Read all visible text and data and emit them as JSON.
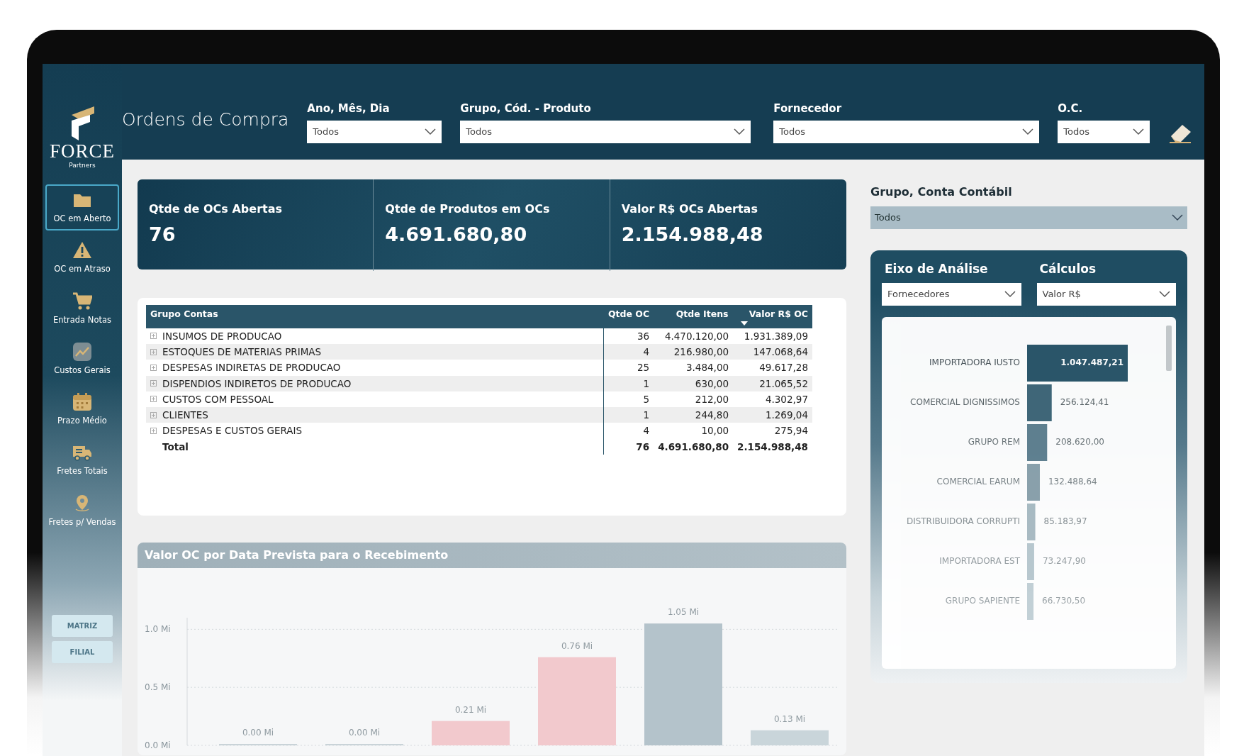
{
  "header": {
    "title": "Ordens de Compra",
    "filters": [
      {
        "label": "Ano, Mês, Dia",
        "value": "Todos"
      },
      {
        "label": "Grupo, Cód. - Produto",
        "value": "Todos"
      },
      {
        "label": "Fornecedor",
        "value": "Todos"
      },
      {
        "label": "O.C.",
        "value": "Todos"
      }
    ]
  },
  "sidebar": {
    "logo": {
      "name": "FORCE",
      "tagline": "Partners"
    },
    "items": [
      {
        "label": "OC em Aberto",
        "kind": "folder",
        "selected": true
      },
      {
        "label": "OC em Atraso",
        "kind": "warning",
        "selected": false
      },
      {
        "label": "Entrada Notas",
        "kind": "cart",
        "selected": false
      },
      {
        "label": "Custos Gerais",
        "kind": "chart",
        "selected": false
      },
      {
        "label": "Prazo Médio",
        "kind": "calendar",
        "selected": false
      },
      {
        "label": "Fretes Totais",
        "kind": "truck",
        "selected": false
      },
      {
        "label": "Fretes p/ Vendas",
        "kind": "pin",
        "selected": false
      }
    ],
    "units": [
      {
        "label": "MATRIZ"
      },
      {
        "label": "FILIAL"
      }
    ]
  },
  "kpis": [
    {
      "label": "Qtde de OCs Abertas",
      "value": "76"
    },
    {
      "label": "Qtde de Produtos em OCs",
      "value": "4.691.680,80"
    },
    {
      "label": "Valor R$ OCs Abertas",
      "value": "2.154.988,48"
    }
  ],
  "table": {
    "columns": [
      {
        "label": "Grupo Contas",
        "sorted": false
      },
      {
        "label": "Qtde OC",
        "sorted": false
      },
      {
        "label": "Qtde Itens",
        "sorted": false
      },
      {
        "label": "Valor R$ OC",
        "sorted": true
      }
    ],
    "rows": [
      [
        "INSUMOS DE PRODUCAO",
        "36",
        "4.470.120,00",
        "1.931.389,09"
      ],
      [
        "ESTOQUES DE MATERIAS PRIMAS",
        "4",
        "216.980,00",
        "147.068,64"
      ],
      [
        "DESPESAS INDIRETAS DE PRODUCAO",
        "25",
        "3.484,00",
        "49.617,28"
      ],
      [
        "DISPENDIOS INDIRETOS DE PRODUCAO",
        "1",
        "630,00",
        "21.065,52"
      ],
      [
        "CUSTOS COM PESSOAL",
        "5",
        "212,00",
        "4.302,97"
      ],
      [
        "CLIENTES",
        "1",
        "244,80",
        "1.269,04"
      ],
      [
        "DESPESAS E CUSTOS GERAIS",
        "4",
        "10,00",
        "275,94"
      ]
    ],
    "total": [
      "Total",
      "76",
      "4.691.680,80",
      "2.154.988,48"
    ]
  },
  "receipt_chart": {
    "title": "Valor OC por Data Prevista para o Recebimento",
    "chart_data": {
      "type": "bar",
      "values": [
        0.0,
        0.0,
        0.21,
        0.76,
        1.05,
        0.13
      ],
      "colors": [
        "#c9d3d8",
        "#c9d3d8",
        "#f2c9cd",
        "#f2c9cd",
        "#b4c3cb",
        "#c9d5da"
      ],
      "value_labels": [
        "0.00 Mi",
        "0.00 Mi",
        "0.21 Mi",
        "0.76 Mi",
        "1.05 Mi",
        "0.13 Mi"
      ],
      "ylim": [
        0,
        1.1
      ],
      "yticks": [
        {
          "value": 0,
          "label": "0.0 Mi"
        },
        {
          "value": 0.5,
          "label": "0.5 Mi"
        },
        {
          "value": 1.0,
          "label": "1.0 Mi"
        }
      ]
    }
  },
  "account_filter": {
    "label": "Grupo, Conta Contábil",
    "value": "Todos"
  },
  "analysis": {
    "filters": [
      {
        "label": "Eixo de Análise",
        "value": "Fornecedores"
      },
      {
        "label": "Cálculos",
        "value": "Valor R$"
      }
    ],
    "chart_data": {
      "type": "bar",
      "orientation": "horizontal",
      "categories": [
        "IMPORTADORA IUSTO",
        "COMERCIAL DIGNISSIMOS",
        "GRUPO REM",
        "COMERCIAL EARUM",
        "DISTRIBUIDORA CORRUPTI",
        "IMPORTADORA EST",
        "GRUPO SAPIENTE"
      ],
      "values": [
        1047487.21,
        256124.41,
        208620.0,
        132488.64,
        85183.97,
        73247.9,
        66730.5
      ],
      "value_labels": [
        "1.047.487,21",
        "256.124,41",
        "208.620,00",
        "132.488,64",
        "85.183,97",
        "73.247,90",
        "66.730,50"
      ]
    }
  }
}
